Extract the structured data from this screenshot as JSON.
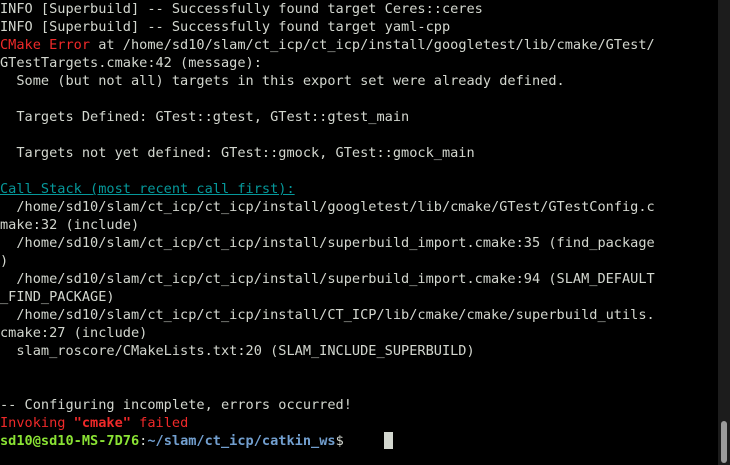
{
  "terminal": {
    "lines": [
      {
        "segments": [
          {
            "text": "INFO [Superbuild] -- Successfully found target Ceres::ceres",
            "color": "default"
          }
        ]
      },
      {
        "segments": [
          {
            "text": "INFO [Superbuild] -- Successfully found target yaml-cpp",
            "color": "default"
          }
        ]
      },
      {
        "segments": [
          {
            "text": "CMake Error",
            "color": "red"
          },
          {
            "text": " at /home/sd10/slam/ct_icp/ct_icp/install/googletest/lib/cmake/GTest/",
            "color": "default"
          }
        ]
      },
      {
        "segments": [
          {
            "text": "GTestTargets.cmake:42 (message):",
            "color": "default"
          }
        ]
      },
      {
        "segments": [
          {
            "text": "  Some (but not all) targets in this export set were already defined.",
            "color": "default"
          }
        ]
      },
      {
        "segments": []
      },
      {
        "segments": [
          {
            "text": "  Targets Defined: GTest::gtest, GTest::gtest_main",
            "color": "default"
          }
        ]
      },
      {
        "segments": []
      },
      {
        "segments": [
          {
            "text": "  Targets not yet defined: GTest::gmock, GTest::gmock_main",
            "color": "default"
          }
        ]
      },
      {
        "segments": []
      },
      {
        "segments": [
          {
            "text": "Call Stack (most recent call first):",
            "color": "cyan-u"
          }
        ]
      },
      {
        "segments": [
          {
            "text": "  /home/sd10/slam/ct_icp/ct_icp/install/googletest/lib/cmake/GTest/GTestConfig.c",
            "color": "default"
          }
        ]
      },
      {
        "segments": [
          {
            "text": "make:32 (include)",
            "color": "default"
          }
        ]
      },
      {
        "segments": [
          {
            "text": "  /home/sd10/slam/ct_icp/ct_icp/install/superbuild_import.cmake:35 (find_package",
            "color": "default"
          }
        ]
      },
      {
        "segments": [
          {
            "text": ")",
            "color": "default"
          }
        ]
      },
      {
        "segments": [
          {
            "text": "  /home/sd10/slam/ct_icp/ct_icp/install/superbuild_import.cmake:94 (SLAM_DEFAULT",
            "color": "default"
          }
        ]
      },
      {
        "segments": [
          {
            "text": "_FIND_PACKAGE)",
            "color": "default"
          }
        ]
      },
      {
        "segments": [
          {
            "text": "  /home/sd10/slam/ct_icp/ct_icp/install/CT_ICP/lib/cmake/cmake/superbuild_utils.",
            "color": "default"
          }
        ]
      },
      {
        "segments": [
          {
            "text": "cmake:27 (include)",
            "color": "default"
          }
        ]
      },
      {
        "segments": [
          {
            "text": "  slam_roscore/CMakeLists.txt:20 (SLAM_INCLUDE_SUPERBUILD)",
            "color": "default"
          }
        ]
      },
      {
        "segments": []
      },
      {
        "segments": []
      },
      {
        "segments": [
          {
            "text": "-- Configuring incomplete, errors occurred!",
            "color": "default"
          }
        ]
      },
      {
        "segments": [
          {
            "text": "Invoking ",
            "color": "red"
          },
          {
            "text": "\"cmake\"",
            "color": "red-bold"
          },
          {
            "text": " failed",
            "color": "red"
          }
        ]
      },
      {
        "segments": [
          {
            "text": "sd10@sd10-MS-7D76",
            "color": "green-bold"
          },
          {
            "text": ":",
            "color": "default"
          },
          {
            "text": "~/slam/ct_icp/catkin_ws",
            "color": "blue-bold"
          },
          {
            "text": "$ ",
            "color": "default"
          }
        ]
      }
    ]
  },
  "scrollbar": {
    "position_fraction": 1.0
  }
}
